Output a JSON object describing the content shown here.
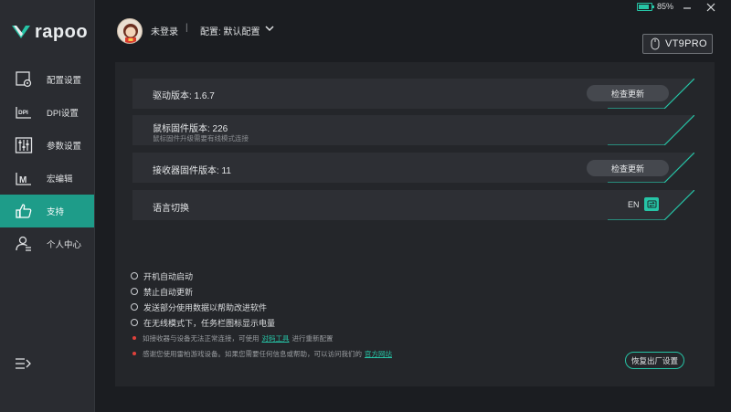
{
  "brand": {
    "logo_text": "rapoo"
  },
  "sidebar": {
    "items": [
      {
        "label": "配置设置",
        "icon": "config-icon"
      },
      {
        "label": "DPI设置",
        "icon": "dpi-icon"
      },
      {
        "label": "参数设置",
        "icon": "sliders-icon"
      },
      {
        "label": "宏编辑",
        "icon": "macro-icon"
      },
      {
        "label": "支持",
        "icon": "thumbs-up-icon",
        "active": true
      },
      {
        "label": "个人中心",
        "icon": "user-icon"
      }
    ],
    "collapse_icon": "menu-collapse-icon"
  },
  "header": {
    "user": "未登录",
    "separator": "|",
    "config": "配置: 默认配置",
    "battery_level": 0.85,
    "battery_text": "85%",
    "device": "VT9PRO"
  },
  "support": {
    "driver_version": "驱动版本: 1.6.7",
    "check_update": "检查更新",
    "mouse_firmware": "鼠标固件版本: 226",
    "mouse_firmware_note": "鼠标固件升级需要有线模式连接",
    "receiver_firmware": "接收器固件版本: 11",
    "language_label": "语言切换",
    "language_current": "EN"
  },
  "options": [
    "开机自动启动",
    "禁止自动更新",
    "发送部分使用数据以帮助改进软件",
    "在无线模式下，任务栏图标显示电量"
  ],
  "notices": {
    "pairing_before": "如接收器与设备无法正常连接，可使用",
    "pairing_link": "对码工具",
    "pairing_after": "进行重新配置",
    "thanks_before": "感谢您使用雷柏游戏设备。如果您需要任何信息或帮助，可以访问我们的",
    "thanks_link": "官方网站"
  },
  "reset_button": "恢复出厂设置",
  "colors": {
    "accent": "#26c4a6",
    "active_nav": "#1e9c89",
    "notice_dot": "#e0413b",
    "background": "#1b1d21",
    "panel": "#24262a",
    "sidebar": "#2a2c31"
  }
}
